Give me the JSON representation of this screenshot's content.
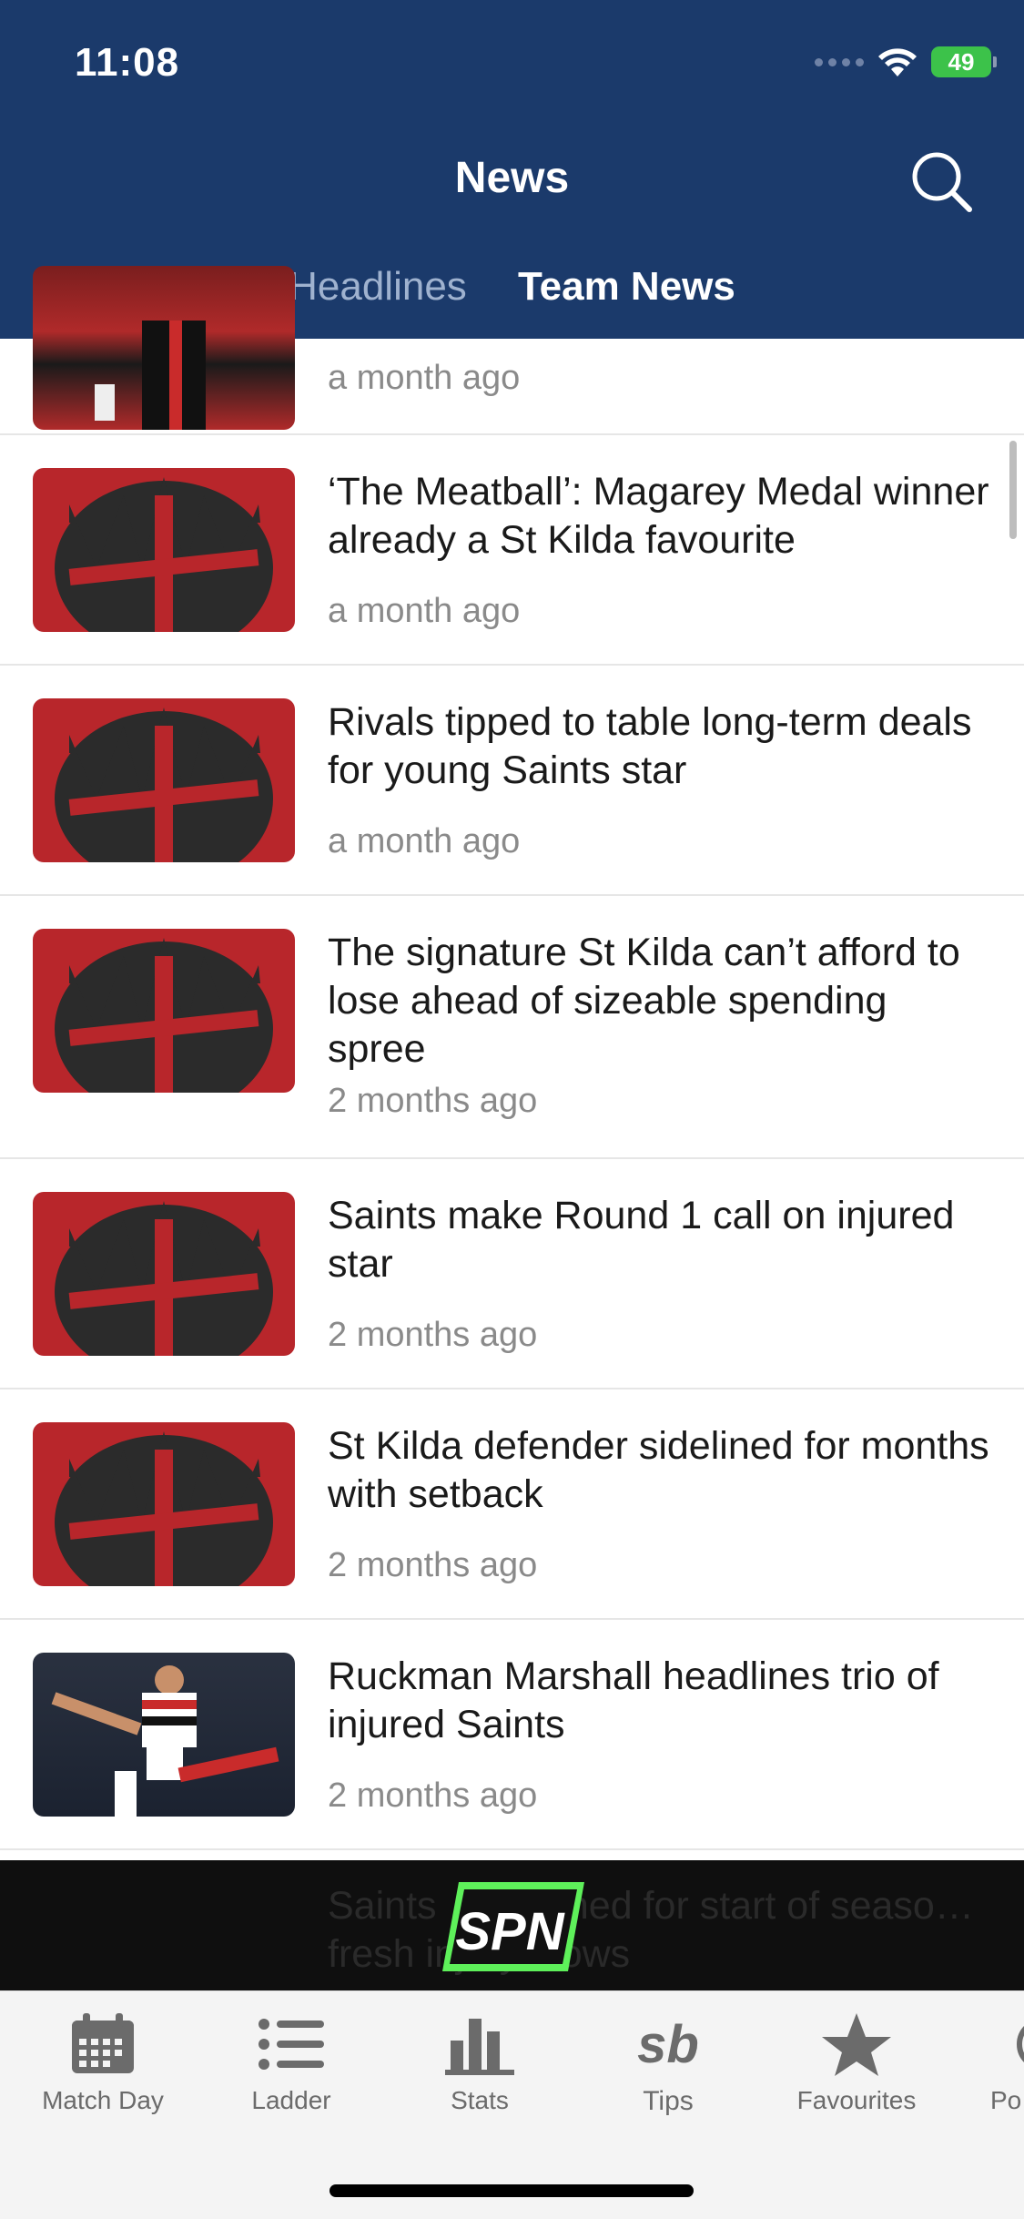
{
  "status_bar": {
    "time": "11:08",
    "battery": "49"
  },
  "header": {
    "title": "News"
  },
  "tabs": [
    {
      "label": "Headlines",
      "active": false
    },
    {
      "label": "Team News",
      "active": true
    }
  ],
  "articles": [
    {
      "title": "",
      "time": "a month ago",
      "thumb": "player-photo"
    },
    {
      "title": "‘The Meatball’: Magarey Medal winner already a St Kilda favourite",
      "time": "a month ago",
      "thumb": "club-logo"
    },
    {
      "title": "Rivals tipped to table long-term deals for young Saints star",
      "time": "a month ago",
      "thumb": "club-logo"
    },
    {
      "title": "The signature St Kilda can’t afford to lose ahead of sizeable spending spree",
      "time": "2 months ago",
      "thumb": "club-logo"
    },
    {
      "title": "Saints make Round 1 call on injured star",
      "time": "2 months ago",
      "thumb": "club-logo"
    },
    {
      "title": "St Kilda defender sidelined for months with setback",
      "time": "2 months ago",
      "thumb": "club-logo"
    },
    {
      "title": "Ruckman Marshall headlines trio of injured Saints",
      "time": "2 months ago",
      "thumb": "player-photo"
    }
  ],
  "ad_banner": {
    "brand": "SPN",
    "behind_text": "Saints … idelined for start of seaso… fresh injury blows"
  },
  "tabbar": [
    {
      "label": "Match Day",
      "icon": "calendar-icon"
    },
    {
      "label": "Ladder",
      "icon": "list-icon"
    },
    {
      "label": "Stats",
      "icon": "bar-chart-icon"
    },
    {
      "label": "Tips",
      "icon": "sb-icon"
    },
    {
      "label": "Favourites",
      "icon": "star-icon"
    },
    {
      "label": "Po",
      "icon": "podcast-icon"
    }
  ],
  "colors": {
    "header_bg": "#1b3a6b",
    "tab_inactive": "#9fb2cf",
    "logo_red": "#b8262b",
    "battery_green": "#3cc24a"
  }
}
